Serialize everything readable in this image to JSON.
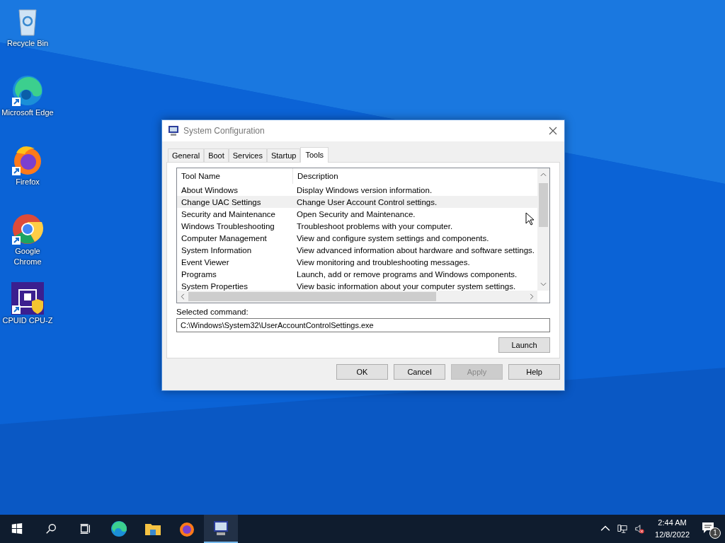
{
  "desktop_icons": [
    {
      "label": "Recycle Bin",
      "kind": "recycle",
      "shortcut": false
    },
    {
      "label": "Microsoft Edge",
      "kind": "edge",
      "shortcut": true
    },
    {
      "label": "Firefox",
      "kind": "firefox",
      "shortcut": true
    },
    {
      "label": "Google Chrome",
      "kind": "chrome",
      "shortcut": true
    },
    {
      "label": "CPUID CPU-Z",
      "kind": "cpuz",
      "shortcut": true
    }
  ],
  "window": {
    "title": "System Configuration",
    "tabs": [
      {
        "label": "General",
        "selected": false
      },
      {
        "label": "Boot",
        "selected": false
      },
      {
        "label": "Services",
        "selected": false
      },
      {
        "label": "Startup",
        "selected": false
      },
      {
        "label": "Tools",
        "selected": true
      }
    ],
    "table": {
      "columns": [
        "Tool Name",
        "Description"
      ],
      "rows": [
        {
          "tool_name": "About Windows",
          "description": "Display Windows version information.",
          "selected": false
        },
        {
          "tool_name": "Change UAC Settings",
          "description": "Change User Account Control settings.",
          "selected": true
        },
        {
          "tool_name": "Security and Maintenance",
          "description": "Open Security and Maintenance.",
          "selected": false
        },
        {
          "tool_name": "Windows Troubleshooting",
          "description": "Troubleshoot problems with your computer.",
          "selected": false
        },
        {
          "tool_name": "Computer Management",
          "description": "View and configure system settings and components.",
          "selected": false
        },
        {
          "tool_name": "System Information",
          "description": "View advanced information about hardware and software settings.",
          "selected": false
        },
        {
          "tool_name": "Event Viewer",
          "description": "View monitoring and troubleshooting messages.",
          "selected": false
        },
        {
          "tool_name": "Programs",
          "description": "Launch, add or remove programs and Windows components.",
          "selected": false
        },
        {
          "tool_name": "System Properties",
          "description": "View basic information about your computer system settings.",
          "selected": false
        }
      ]
    },
    "selected_command": {
      "label": "Selected command:",
      "value": "C:\\Windows\\System32\\UserAccountControlSettings.exe"
    },
    "launch_button": "Launch",
    "buttons": [
      {
        "label": "OK",
        "disabled": false
      },
      {
        "label": "Cancel",
        "disabled": false
      },
      {
        "label": "Apply",
        "disabled": true
      },
      {
        "label": "Help",
        "disabled": false
      }
    ]
  },
  "taskbar": {
    "apps": [
      {
        "kind": "edge",
        "active": false
      },
      {
        "kind": "explorer",
        "active": false
      },
      {
        "kind": "firefox",
        "active": false
      },
      {
        "kind": "msconfig",
        "active": true
      }
    ],
    "volume_muted": true,
    "clock": {
      "time": "2:44 AM",
      "date": "12/8/2022"
    },
    "notification_count": "1"
  }
}
